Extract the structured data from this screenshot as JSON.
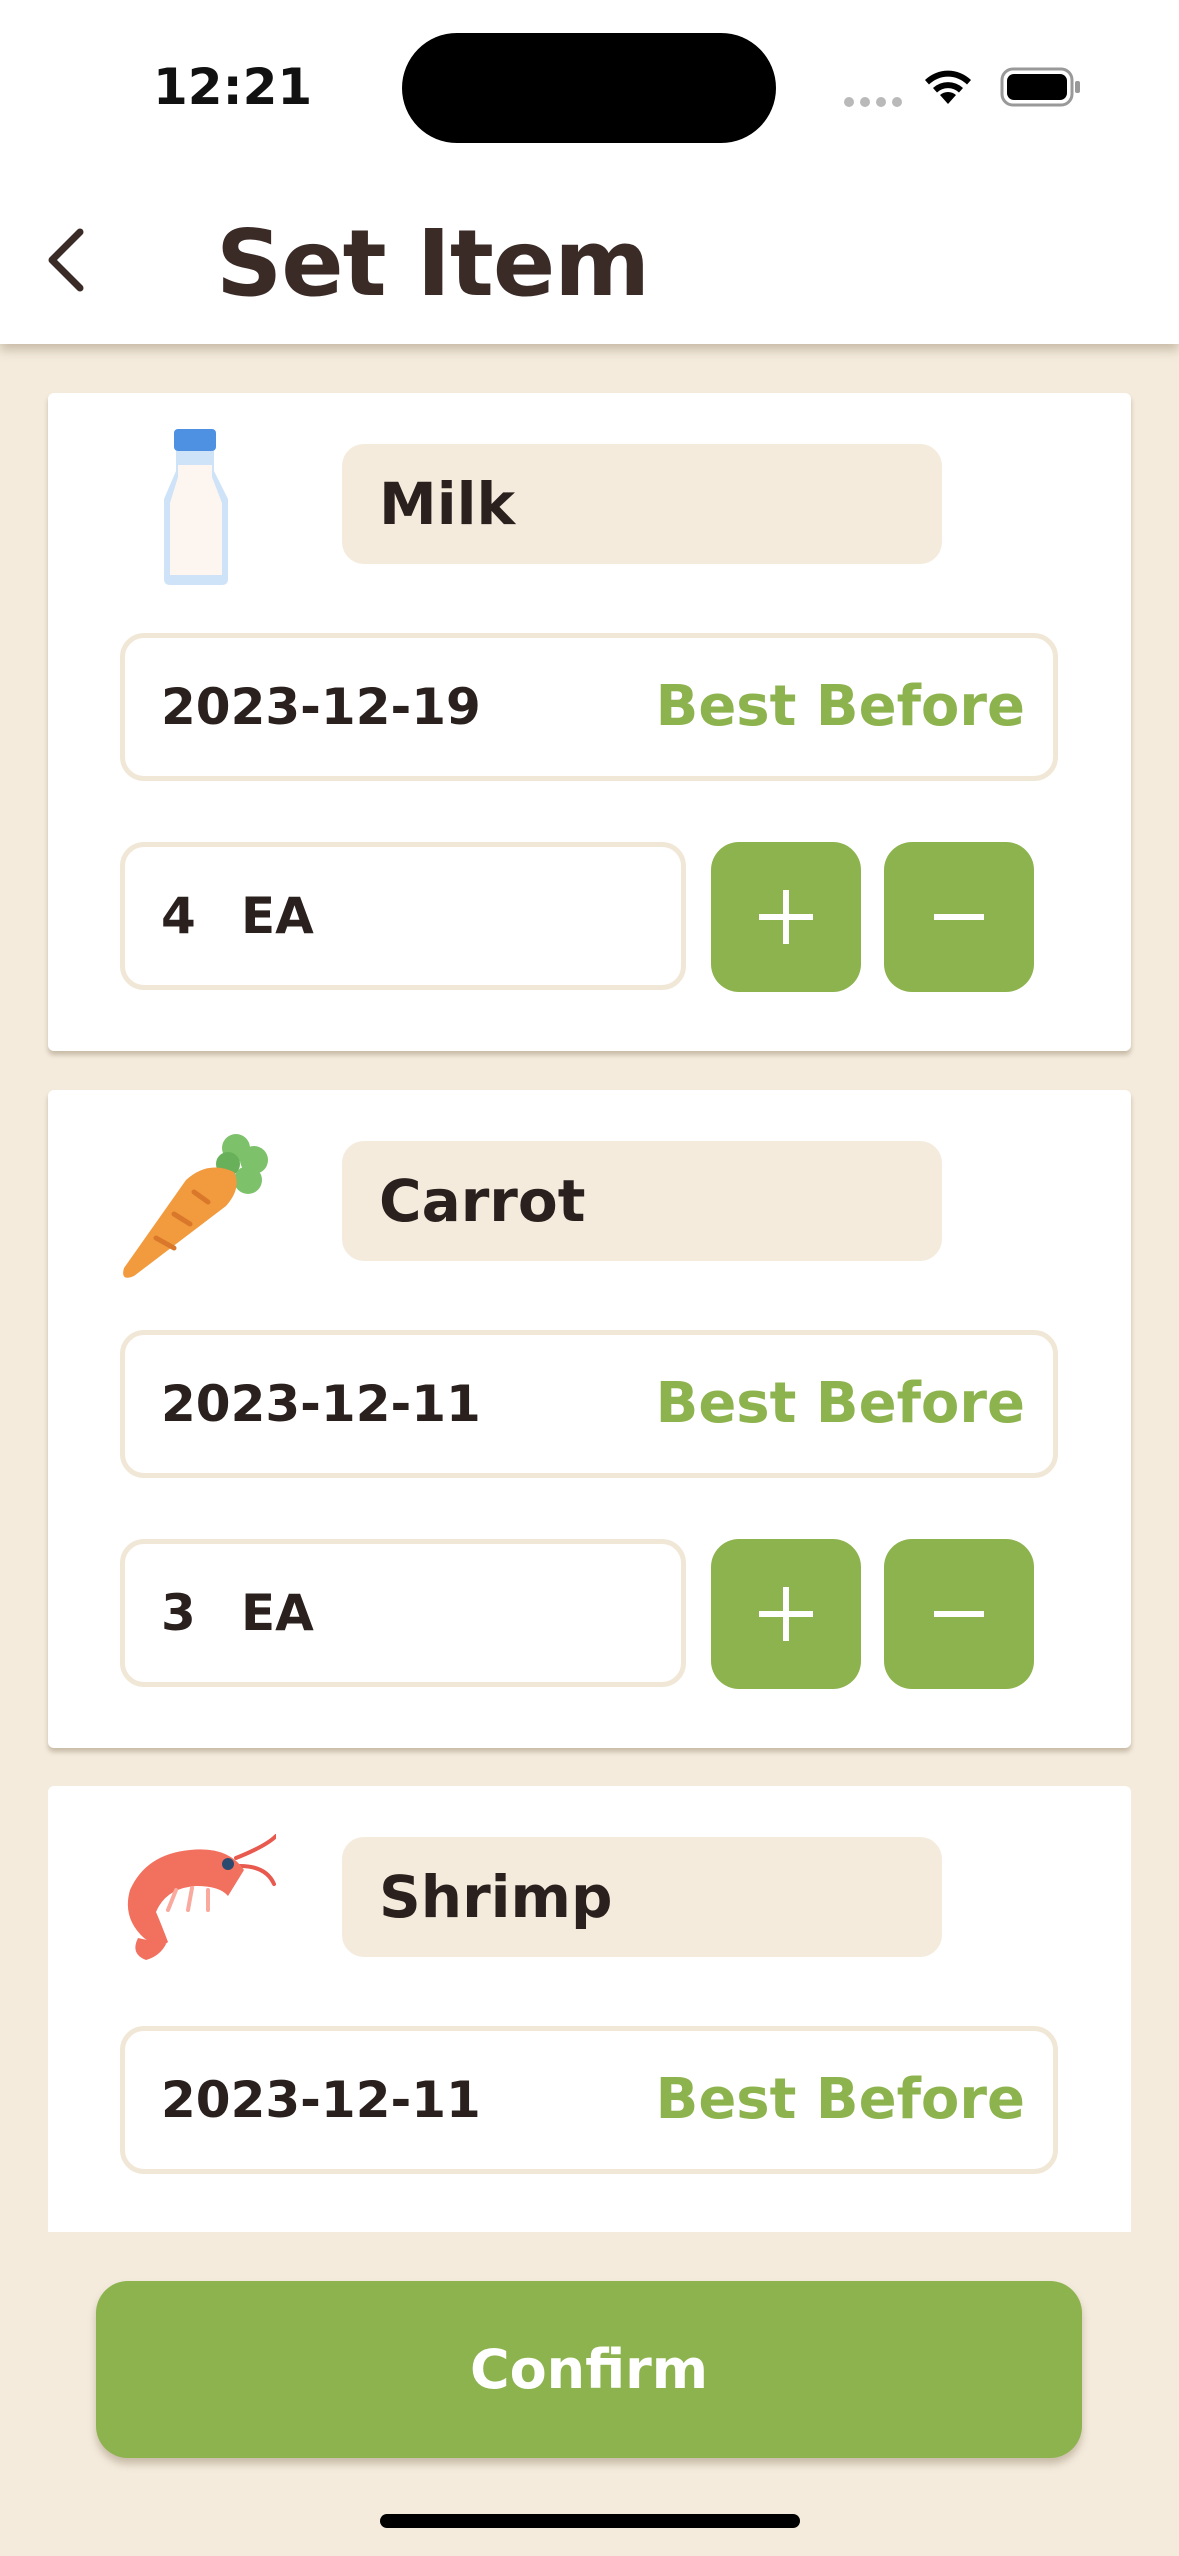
{
  "status_bar": {
    "time": "12:21"
  },
  "header": {
    "title": "Set Item"
  },
  "items": [
    {
      "name": "Milk",
      "icon": "milk-bottle-icon",
      "date": "2023-12-19",
      "date_label": "Best Before",
      "quantity": "4",
      "unit": "EA"
    },
    {
      "name": "Carrot",
      "icon": "carrot-icon",
      "date": "2023-12-11",
      "date_label": "Best Before",
      "quantity": "3",
      "unit": "EA"
    },
    {
      "name": "Shrimp",
      "icon": "shrimp-icon",
      "date": "2023-12-11",
      "date_label": "Best Before"
    }
  ],
  "footer": {
    "confirm_label": "Confirm"
  },
  "colors": {
    "accent": "#8DB34E",
    "background": "#F4EBDD",
    "title": "#3A2B27"
  }
}
